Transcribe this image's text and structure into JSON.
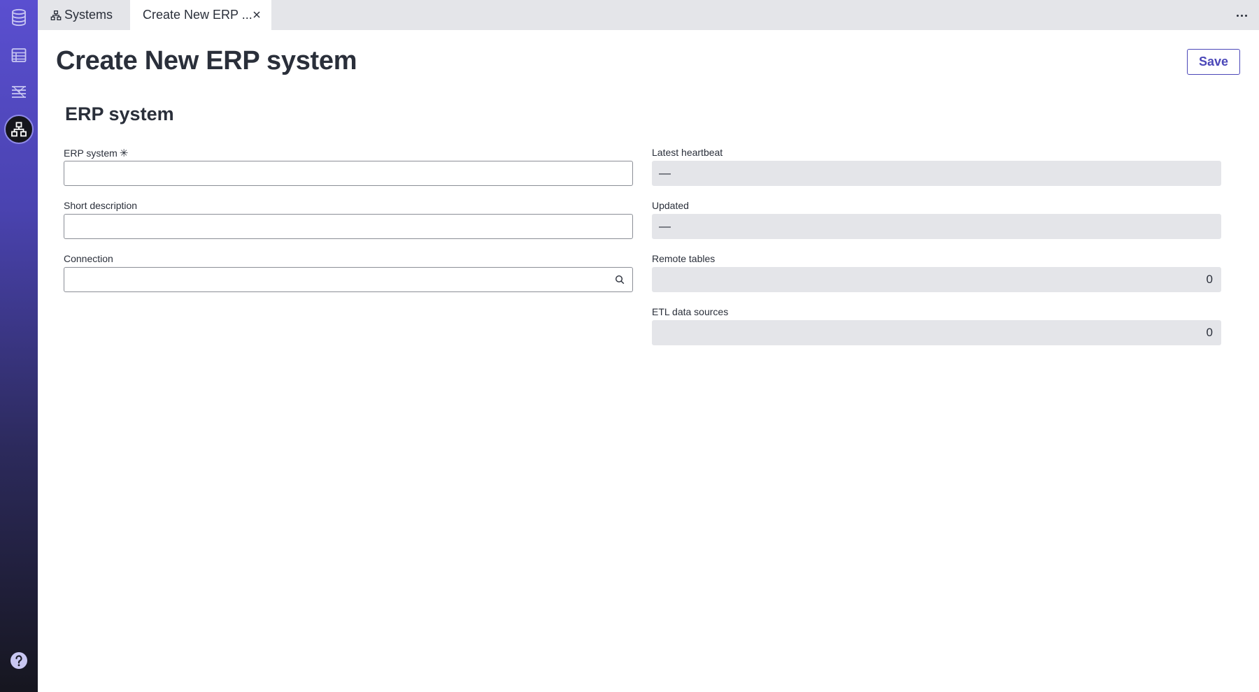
{
  "tabs": {
    "systems_label": "Systems",
    "active_label": "Create New ERP ..."
  },
  "page": {
    "title": "Create New ERP system",
    "save_label": "Save"
  },
  "section": {
    "title": "ERP system"
  },
  "form": {
    "erp_system": {
      "label": "ERP system",
      "required_marker": "✳",
      "value": ""
    },
    "short_description": {
      "label": "Short description",
      "value": ""
    },
    "connection": {
      "label": "Connection",
      "value": ""
    },
    "latest_heartbeat": {
      "label": "Latest heartbeat",
      "value": "—"
    },
    "updated": {
      "label": "Updated",
      "value": "—"
    },
    "remote_tables": {
      "label": "Remote tables",
      "value": "0"
    },
    "etl_data_sources": {
      "label": "ETL data sources",
      "value": "0"
    }
  },
  "rail": {
    "items": [
      "database-icon",
      "table-icon",
      "layers-icon",
      "systems-icon"
    ],
    "active": "systems-icon",
    "help": "help-icon"
  },
  "colors": {
    "accent": "#4b47b8",
    "readonly_bg": "#e4e5e9",
    "tabbar_bg": "#e4e5e9"
  }
}
